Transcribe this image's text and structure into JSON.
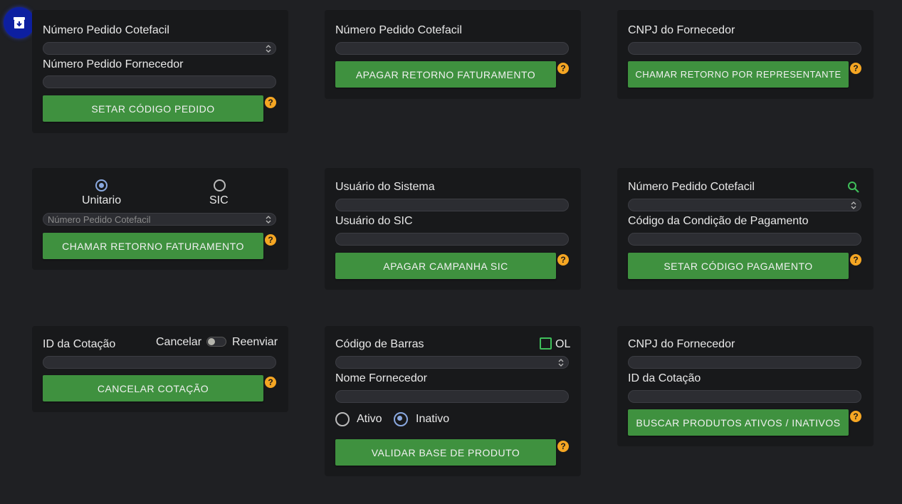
{
  "fab": {
    "icon": "archive-download-icon",
    "color": "#0d1fa0"
  },
  "card1": {
    "label1": "Número Pedido Cotefacil",
    "label2": "Número Pedido Fornecedor",
    "button": "SETAR CÓDIGO PEDIDO"
  },
  "card2": {
    "label1": "Número Pedido Cotefacil",
    "button": "APAGAR RETORNO FATURAMENTO"
  },
  "card3": {
    "label1": "CNPJ do Fornecedor",
    "button": "CHAMAR RETORNO POR REPRESENTANTE"
  },
  "card4": {
    "radio1": "Unitario",
    "radio2": "SIC",
    "placeholder": "Número Pedido Cotefacil",
    "button": "CHAMAR RETORNO FATURAMENTO"
  },
  "card5": {
    "label1": "Usuário do Sistema",
    "label2": "Usuário do SIC",
    "button": "APAGAR CAMPANHA SIC"
  },
  "card6": {
    "label1": "Número Pedido Cotefacil",
    "label2": "Código da Condição de Pagamento",
    "button": "SETAR CÓDIGO PAGAMENTO"
  },
  "card7": {
    "label1": "ID da Cotação",
    "toggle_left": "Cancelar",
    "toggle_right": "Reenviar",
    "button": "CANCELAR COTAÇÃO"
  },
  "card8": {
    "label1": "Código de Barras",
    "checkbox": "OL",
    "label2": "Nome Fornecedor",
    "radio1": "Ativo",
    "radio2": "Inativo",
    "button": "VALIDAR BASE DE PRODUTO"
  },
  "card9": {
    "label1": "CNPJ do Fornecedor",
    "label2": "ID da Cotação",
    "button": "BUSCAR PRODUTOS ATIVOS / INATIVOS"
  },
  "help_glyph": "?",
  "colors": {
    "accent_green": "#3f913f",
    "help_orange": "#f5a623",
    "radio_blue": "#8aa9e0"
  }
}
